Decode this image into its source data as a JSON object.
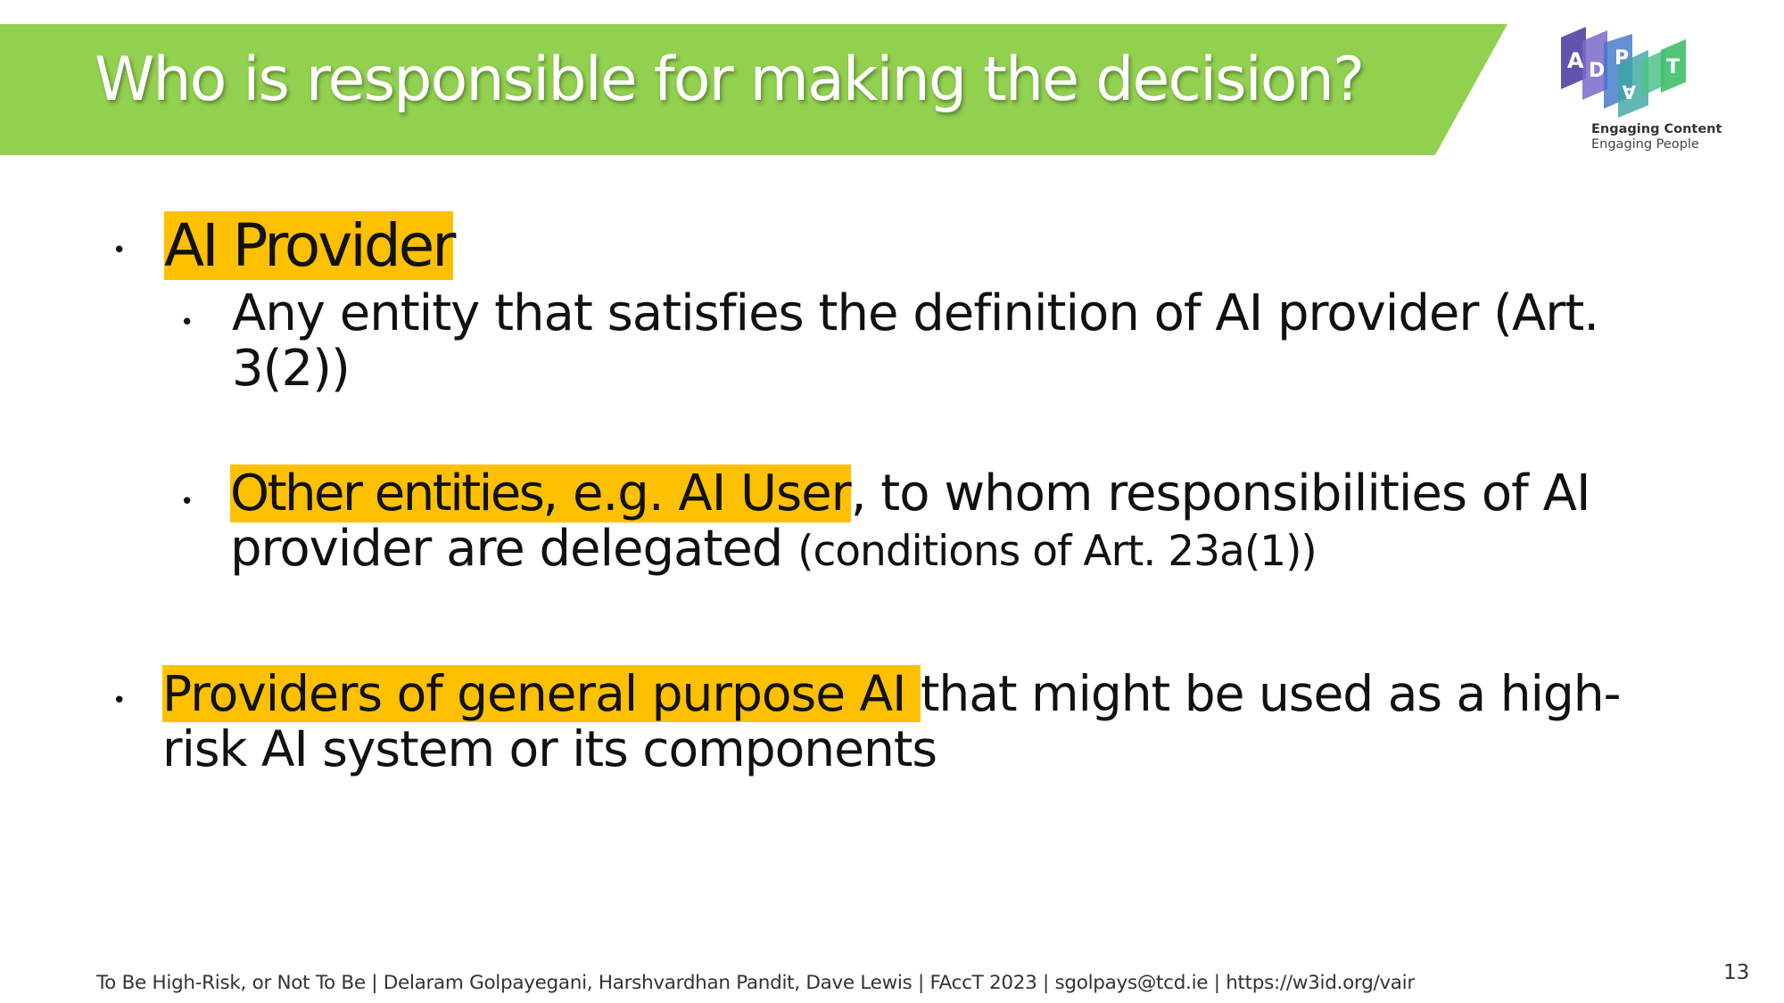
{
  "slide": {
    "title": "Who is responsible for making the decision?",
    "logo": {
      "letters": [
        "A",
        "D",
        "A",
        "P",
        "T"
      ],
      "line1": "Engaging Content",
      "line2": "Engaging People"
    },
    "bullets": {
      "b1": {
        "highlight": "AI Provider"
      },
      "b1a": {
        "line1": "Any entity that satisfies the definition of AI provider (Art.",
        "line2": "3(2))"
      },
      "b1b": {
        "hl_bold": "Other entities",
        "hl_rest": ", e.g. AI User",
        "after": ", to whom responsibilities of AI",
        "line2_main": "provider are delegated ",
        "line2_small": "(conditions of Art. 23a(1))"
      },
      "b2": {
        "highlight": "Providers of general purpose AI ",
        "after": "that might be used as a high-",
        "line2": "risk AI system or its components"
      }
    },
    "footer": "To Be High-Risk, or Not To Be | Delaram Golpayegani, Harshvardhan Pandit, Dave Lewis | FAccT 2023 | sgolpays@tcd.ie | https://w3id.org/vair",
    "page_number": "13",
    "colors": {
      "title_bar": "#92d050",
      "highlight": "#ffc000",
      "text": "#111111"
    }
  }
}
